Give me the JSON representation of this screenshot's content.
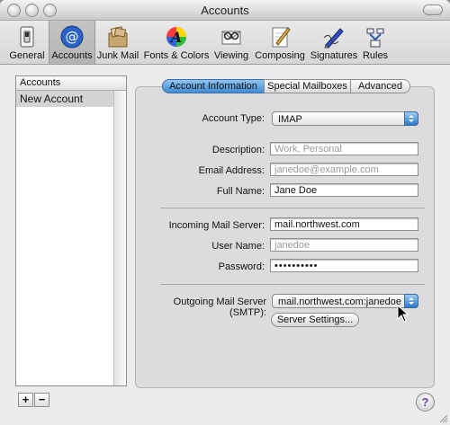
{
  "window": {
    "title": "Accounts"
  },
  "toolbar": {
    "items": [
      {
        "label": "General"
      },
      {
        "label": "Accounts"
      },
      {
        "label": "Junk Mail"
      },
      {
        "label": "Fonts & Colors"
      },
      {
        "label": "Viewing"
      },
      {
        "label": "Composing"
      },
      {
        "label": "Signatures"
      },
      {
        "label": "Rules"
      }
    ],
    "selected": "Accounts"
  },
  "sidebar": {
    "header": "Accounts",
    "items": [
      "New Account"
    ],
    "add_label": "+",
    "remove_label": "−"
  },
  "tabs": {
    "items": [
      "Account Information",
      "Special Mailboxes",
      "Advanced"
    ],
    "selected": "Account Information"
  },
  "form": {
    "account_type_label": "Account Type:",
    "account_type_value": "IMAP",
    "description_label": "Description:",
    "description_placeholder": "Work, Personal",
    "email_label": "Email Address:",
    "email_placeholder": "janedoe@example.com",
    "fullname_label": "Full Name:",
    "fullname_value": "Jane Doe",
    "incoming_label": "Incoming Mail Server:",
    "incoming_value": "mail.northwest.com",
    "username_label": "User Name:",
    "username_placeholder": "janedoe",
    "password_label": "Password:",
    "password_value": "••••••••••",
    "outgoing_label": "Outgoing Mail Server (SMTP):",
    "outgoing_value": "mail.northwest.com:janedoe",
    "server_settings_label": "Server Settings..."
  },
  "help": {
    "label": "?"
  },
  "colors": {
    "accent": "#3f8bd3",
    "window_bg": "#ececec",
    "panel_bg": "#dcdcdc"
  }
}
